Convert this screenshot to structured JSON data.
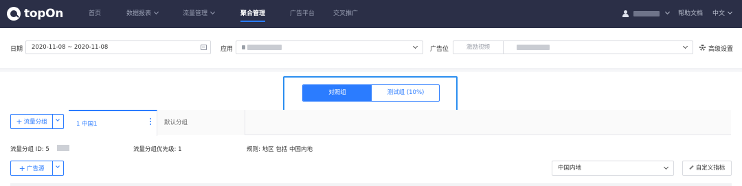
{
  "nav": {
    "logo": "topOn",
    "items": [
      "首页",
      "数据报表",
      "流量管理",
      "聚合管理",
      "广告平台",
      "交叉推广"
    ],
    "active": "聚合管理",
    "help": "帮助文档",
    "lang": "中文"
  },
  "filters": {
    "date_label": "日期",
    "date_value": "2020-11-08 ~ 2020-11-08",
    "app_label": "应用",
    "adpos_label": "广告位",
    "adpos_type": "激励视频",
    "advanced": "高级设置"
  },
  "toggle": {
    "control": "对照组",
    "test": "测试组 (10%)"
  },
  "groups": {
    "add_label": "流量分组",
    "tab_active": "1 中国1",
    "tab_default": "默认分组"
  },
  "meta": {
    "group_id": "流量分组 ID: 5",
    "priority": "流量分组优先级: 1",
    "rule": "规则: 地区 包括 中国内地"
  },
  "sources": {
    "add_label": "广告源",
    "region_value": "中国内地",
    "custom_metrics": "自定义指标"
  },
  "colors": {
    "nav_bg": "#2b2f47",
    "accent": "#2b7cff",
    "highlight": "#2b8ef0"
  }
}
